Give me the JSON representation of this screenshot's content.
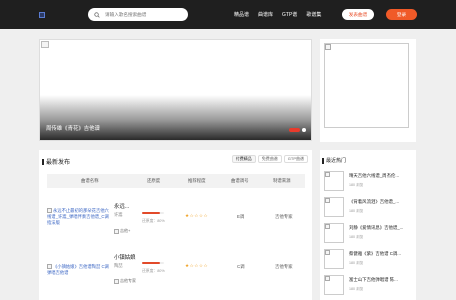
{
  "header": {
    "logo_alt": "",
    "search_placeholder": "请输入歌名搜索曲谱",
    "nav": [
      "精品谱",
      "曲谱库",
      "GTP谱",
      "歌谱集"
    ],
    "post_label": "发表曲谱",
    "login_label": "登录"
  },
  "banner": {
    "caption": "周传雄《青花》吉他谱",
    "slides": 2,
    "active_slide": 1
  },
  "latest": {
    "title": "最新发布",
    "filters": [
      "付费精品",
      "免费曲谱",
      "GTP曲谱"
    ],
    "active_filter": 0,
    "columns": [
      "曲谱名称",
      "还原度",
      "推荐程度",
      "曲谱调号",
      "制谱来源"
    ],
    "rows": [
      {
        "thumb_alt": "永远不止最初的那朵花吉他六线谱_许嵩_弹唱伴奏吉他谱_C调指法版",
        "title": "永远...",
        "artist": "许嵩",
        "uploader": "吉他+",
        "rate_label": "还原度：",
        "rate_value": "80%",
        "rate": 0.8,
        "stars": "★☆☆☆☆",
        "key": "E调",
        "source": "吉他专家"
      },
      {
        "thumb_alt": "《小镇姑娘》吉他谱陶喆 C调弹唱吉他谱",
        "title": "小镇姑娘",
        "artist": "陶喆",
        "uploader": "吉他专家",
        "rate_label": "还原度：",
        "rate_value": "80%",
        "rate": 0.8,
        "stars": "★☆☆☆☆",
        "key": "C调",
        "source": "吉他专家"
      }
    ]
  },
  "hot": {
    "title": "最近热门",
    "items": [
      {
        "name": "晴天吉他六线谱_周杰伦...",
        "views": "180 浏览"
      },
      {
        "name": "《背着风流泪》吉他谱_...",
        "views": "180 浏览"
      },
      {
        "name": "刘静《爱情讯息》吉他谱_...",
        "views": "180 浏览"
      },
      {
        "name": "蔡健雅《紫》吉他谱 C调...",
        "views": "180 浏览"
      },
      {
        "name": "富士山下吉他弹唱谱 陈...",
        "views": "180 浏览"
      }
    ]
  }
}
